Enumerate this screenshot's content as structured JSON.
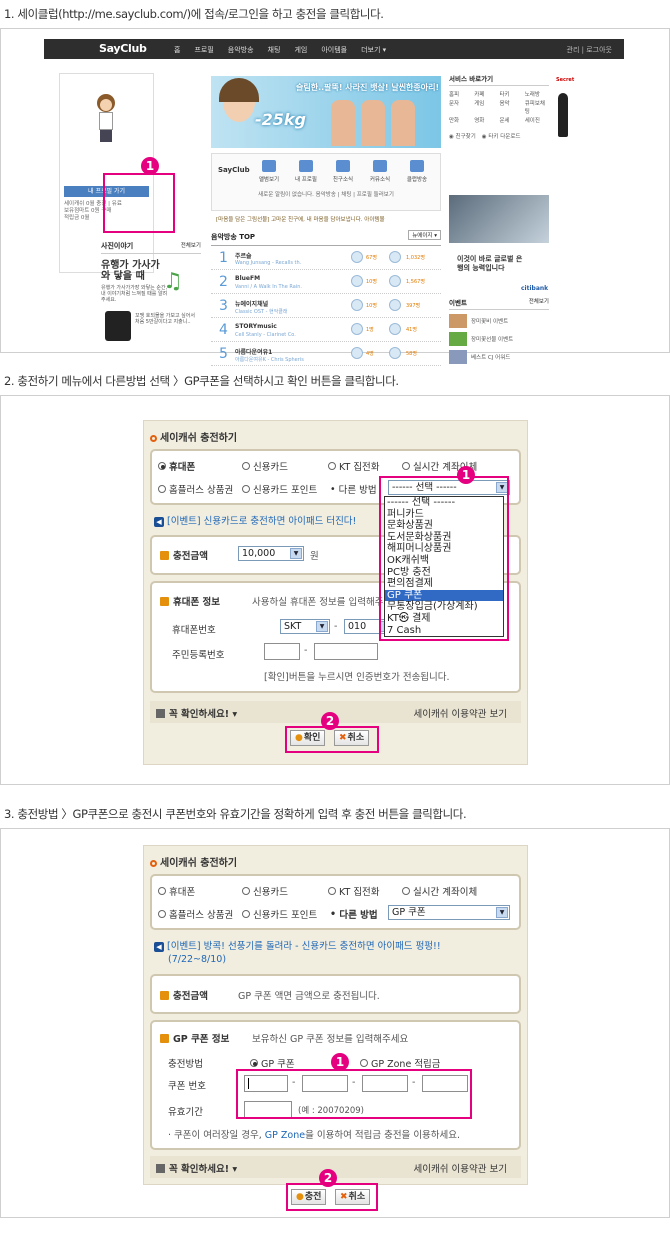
{
  "step1": {
    "title": "1. 세이클럽(http://me.sayclub.com/)에 접속/로그인을 하고 충전을 클릭합니다.",
    "site": {
      "logo": "SayClub",
      "menu": [
        "홈",
        "프로필",
        "음악방송",
        "채팅",
        "게임",
        "아이템몰",
        "더보기 ▾"
      ],
      "right": "관리 | 로그아웃",
      "profile_button": "내 프로필 가기",
      "profile_stats": [
        "세이캐쉬 0월 충전 | 유료",
        "보유점마트 0원 구매",
        "적립금 0월"
      ],
      "story_title": "사진이야기",
      "story_more": "전체보기",
      "story_big": "유행가 가사가 와 닿을 때",
      "story_small": "유행가 가사가가장 와닿는 순간, 내 이야기처럼 느껴질 때를 알려주세요.",
      "story_item": "꼬맹 호되몰을 가보고 싶어서 처음 5만갈이다고 지출니..",
      "banner_slogan": "슬림한..팔뚝! 사라진 뱃살! 날씬한종아리!",
      "banner_kg": "-25kg",
      "svc_logo": "SayClub",
      "svc_items": [
        "앨범보기",
        "내 프로필",
        "친구소식",
        "커뮤소식",
        "클럽방송"
      ],
      "svc_notice": "새로운 알림이 없습니다. 음악방송 | 채팅 | 프로필 둘러보기",
      "ticker": "[마음을 담은 그림선물] 고마운 친구에, 내 마음을 담아보냅니다. 아이템몰",
      "chart_title": "음악방송 TOP",
      "chart_select": "뉴에이지 ▾",
      "chart_rows": [
        {
          "rank": "1",
          "name": "주르슬",
          "sub": "Wang Junsang - Recalls th.",
          "c1": "67명",
          "c2": "1,032명"
        },
        {
          "rank": "2",
          "name": "BlueFM",
          "sub": "Vanni / A Walk In The Rain.",
          "c1": "10명",
          "c2": "1,567명"
        },
        {
          "rank": "3",
          "name": "뉴에이지채널",
          "sub": "Classic OST - 현악클래",
          "c1": "10명",
          "c2": "397명"
        },
        {
          "rank": "4",
          "name": "STORYmusic",
          "sub": "Cell Stanly - Clarinet Co.",
          "c1": "1명",
          "c2": "41명"
        },
        {
          "rank": "5",
          "name": "아름다운여유1",
          "sub": "아름다운여유K - Chris Spheris",
          "c1": "4명",
          "c2": "58명"
        }
      ],
      "side_title": "서비스 바로가기",
      "side_grid": [
        "홈피",
        "카페",
        "타키",
        "노래방",
        "문자",
        "게임",
        "음악",
        "큐피보채팅",
        "만화",
        "영화",
        "운세",
        "세이진"
      ],
      "ad_text": "이것이 바로 글로벌 은행의 능력입니다",
      "ad_logo": "citibank",
      "event_title": "이벤트",
      "event_more": "전체보기",
      "event_items": [
        "장미꽃비 이벤트",
        "장미꽃선물 이벤트",
        "베스트 CJ 어워드"
      ],
      "secret_label": "Secret"
    }
  },
  "step2": {
    "title": "2. 충전하기 메뉴에서 다른방법 선택 〉GP쿠폰을 선택하시고 확인 버튼을 클릭합니다.",
    "form_title": "세이캐쉬 충전하기",
    "methods_row1": [
      "휴대폰",
      "신용카드",
      "KT 집전화",
      "실시간 계좌이체"
    ],
    "methods_row2": [
      "홈플러스 상품권",
      "신용카드 포인트"
    ],
    "other_label": "다른 방법",
    "other_select": "------ 선택 ------",
    "event": "[이벤트] 신용카드로 충전하면 아이패드 터진다!",
    "amount_label": "충전금액",
    "amount_value": "10,000",
    "amount_unit": "원",
    "phone_label": "휴대폰 정보",
    "phone_desc": "사용하실 휴대폰 정보를 입력해주세요",
    "phone_no_label": "휴대폰번호",
    "carrier": "SKT",
    "prefix": "010",
    "rrn_label": "주민등록번호",
    "phone_notice": "[확인]버튼을 누르시면 인증번호가 전송됩니다.",
    "confirm_note": "꼭 확인하세요! ▾",
    "terms": "세이캐쉬 이용약관 보기",
    "ok_button": "확인",
    "cancel_button": "취소",
    "dropdown_options": [
      "------ 선택 ------",
      "퍼니카드",
      "문화상품권",
      "도서문화상품권",
      "해피머니상품권",
      "OK캐쉬백",
      "PC방 충전",
      "편의점결제",
      "GP 쿠폰",
      "무통장입금(가상계좌)",
      "KT㉿ 결제",
      "7 Cash"
    ],
    "dropdown_selected": "GP 쿠폰"
  },
  "step3": {
    "title": "3. 충전방법 〉GP쿠폰으로 충전시 쿠폰번호와 유효기간을 정확하게 입력 후 충전 버튼을 클릭합니다.",
    "form_title": "세이캐쉬 충전하기",
    "methods_row1": [
      "휴대폰",
      "신용카드",
      "KT 집전화",
      "실시간 계좌이체"
    ],
    "methods_row2": [
      "홈플러스 상품권",
      "신용카드 포인트"
    ],
    "other_label": "다른 방법",
    "other_select": "GP 쿠폰",
    "event_line1": "[이벤트] 방콕! 선풍기를 돌려라 - 신용카드 충전하면 아이패드 펑펑!!",
    "event_line2": "(7/22~8/10)",
    "amount_label": "충전금액",
    "amount_desc": "GP 쿠폰 액면 금액으로 충전됩니다.",
    "coupon_label": "GP 쿠폰 정보",
    "coupon_desc": "보유하신 GP 쿠폰 정보를 입력해주세요",
    "method_label": "충전방법",
    "method_opt1": "GP 쿠폰",
    "method_opt2": "GP Zone 적립금",
    "coupon_no_label": "쿠폰 번호",
    "expiry_label": "유효기간",
    "expiry_hint": "(예 : 20070209)",
    "coupon_notice_pre": "· 쿠폰이 여러장일 경우,",
    "coupon_notice_link": "GP Zone",
    "coupon_notice_post": "을 이용하여 적립금 충전을 이용하세요.",
    "confirm_note": "꼭 확인하세요! ▾",
    "terms": "세이캐쉬 이용약관 보기",
    "charge_button": "충전",
    "cancel_button": "취소"
  },
  "badges": {
    "one": "1",
    "two": "2"
  },
  "colors": {
    "highlight": "#e4007f",
    "accent": "#e5900c",
    "link": "#1f67b6"
  }
}
